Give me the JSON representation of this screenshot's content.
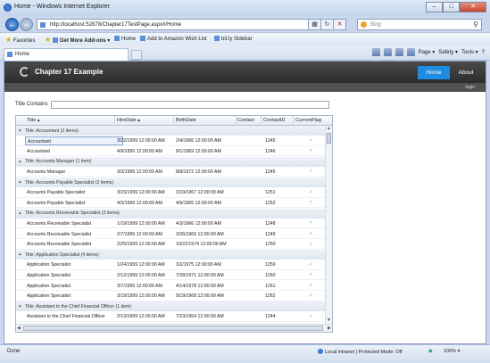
{
  "window": {
    "title": "Home - Windows Internet Explorer",
    "url": "http://localhost:52878/Chapter17TestPage.aspx#/Home",
    "search_placeholder": "Bing"
  },
  "favorites": {
    "label": "Favorites",
    "items": [
      "Get More Add-ons ▾",
      "Home",
      "Add to Amazon Wish List",
      "bit.ly Sidebar"
    ]
  },
  "tab": {
    "label": "Home"
  },
  "commandbar": {
    "page": "Page ▾",
    "safety": "Safety ▾",
    "tools": "Tools ▾",
    "help": "?"
  },
  "app": {
    "title": "Chapter 17 Example",
    "nav": [
      "Home",
      "About"
    ],
    "login": "login",
    "filter_label": "Title Contains"
  },
  "grid": {
    "headers": [
      "Title ▴",
      "HireDate ▴",
      "BirthDate",
      "Contact",
      "ContactID",
      "CurrentFlag"
    ],
    "rows": [
      {
        "type": "group",
        "text": "Title: Accountant (2 items)"
      },
      {
        "type": "data",
        "title": "Accountant",
        "hire": "3/22/1999 12:00:00 AM",
        "birth": "2/4/1966 12:00:00 AM",
        "id": "1245",
        "sel": true
      },
      {
        "type": "data",
        "title": "Accountant",
        "hire": "4/9/1999 12:00:00 AM",
        "birth": "8/1/1969 12:00:00 AM",
        "id": "1246"
      },
      {
        "type": "group",
        "text": "Title: Accounts Manager (1 item)"
      },
      {
        "type": "data",
        "title": "Accounts Manager",
        "hire": "3/3/1999 12:00:00 AM",
        "birth": "8/8/1972 12:00:00 AM",
        "id": "1245"
      },
      {
        "type": "group",
        "text": "Title: Accounts Payable Specialist (2 items)"
      },
      {
        "type": "data",
        "title": "Accounts Payable Specialist",
        "hire": "3/15/1999 12:00:00 AM",
        "birth": "3/19/1967 12:00:00 AM",
        "id": "1251"
      },
      {
        "type": "data",
        "title": "Accounts Payable Specialist",
        "hire": "4/3/1999 12:00:00 AM",
        "birth": "4/9/1965 12:00:00 AM",
        "id": "1252"
      },
      {
        "type": "group",
        "text": "Title: Accounts Receivable Specialist (3 items)"
      },
      {
        "type": "data",
        "title": "Accounts Receivable Specialist",
        "hire": "1/19/1999 12:00:00 AM",
        "birth": "4/3/1966 12:00:00 AM",
        "id": "1248"
      },
      {
        "type": "data",
        "title": "Accounts Receivable Specialist",
        "hire": "2/7/1999 12:00:00 AM",
        "birth": "3/26/1966 12:00:00 AM",
        "id": "1249"
      },
      {
        "type": "data",
        "title": "Accounts Receivable Specialist",
        "hire": "2/25/1999 12:00:00 AM",
        "birth": "10/22/1974 12:00:00 AM",
        "id": "1250"
      },
      {
        "type": "group",
        "text": "Title: Application Specialist (4 items)"
      },
      {
        "type": "data",
        "title": "Application Specialist",
        "hire": "1/24/1999 12:00:00 AM",
        "birth": "3/2/1975 12:00:00 AM",
        "id": "1259"
      },
      {
        "type": "data",
        "title": "Application Specialist",
        "hire": "2/12/1999 12:00:00 AM",
        "birth": "7/28/1971 12:00:00 AM",
        "id": "1260"
      },
      {
        "type": "data",
        "title": "Application Specialist",
        "hire": "3/7/1999 12:00:00 AM",
        "birth": "4/14/1978 12:00:00 AM",
        "id": "1261"
      },
      {
        "type": "data",
        "title": "Application Specialist",
        "hire": "3/19/1999 12:00:00 AM",
        "birth": "9/19/1968 12:00:00 AM",
        "id": "1262"
      },
      {
        "type": "group",
        "text": "Title: Assistant to the Chief Financial Officer (1 item)"
      },
      {
        "type": "data",
        "title": "Assistant to the Chief Financial Officer",
        "hire": "2/13/1999 12:00:00 AM",
        "birth": "7/23/1954 12:00:00 AM",
        "id": "1244"
      }
    ]
  },
  "status": {
    "left": "Done",
    "zone": "Local intranet | Protected Mode: Off",
    "zoom": "100% ▾"
  }
}
